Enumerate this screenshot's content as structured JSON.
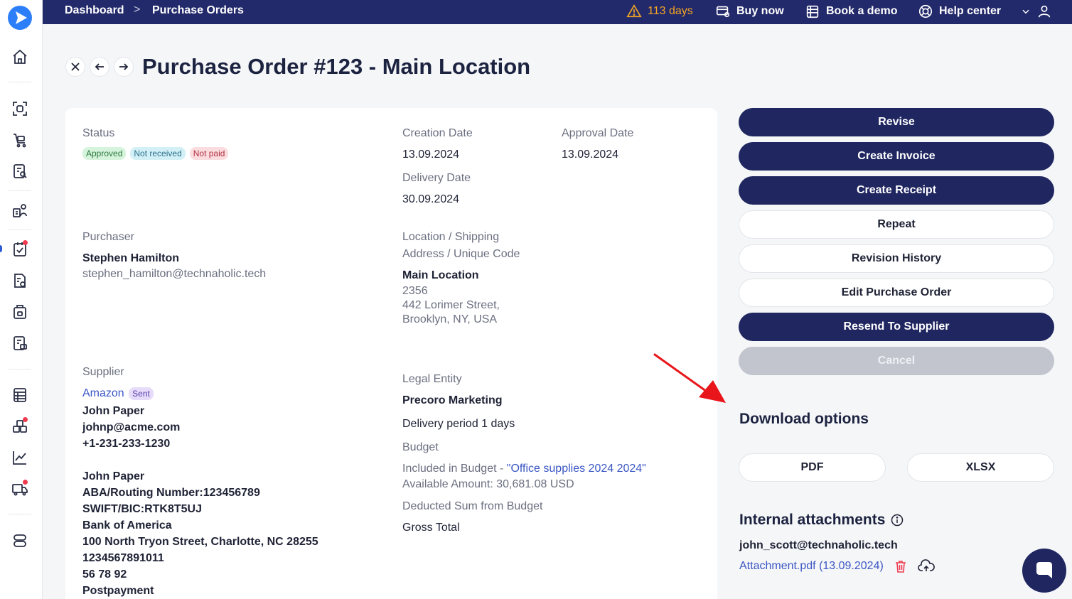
{
  "breadcrumb": {
    "home": "Dashboard",
    "separator": ">",
    "current": "Purchase Orders"
  },
  "topbar": {
    "trial": "113 days",
    "buy": "Buy now",
    "demo": "Book a demo",
    "help": "Help center"
  },
  "page": {
    "title": "Purchase Order #123 - Main Location"
  },
  "details": {
    "status_label": "Status",
    "badges": [
      "Approved",
      "Not received",
      "Not paid"
    ],
    "creation_label": "Creation Date",
    "creation_value": "13.09.2024",
    "approval_label": "Approval Date",
    "approval_value": "13.09.2024",
    "delivery_label": "Delivery Date",
    "delivery_value": "30.09.2024",
    "purchaser_label": "Purchaser",
    "purchaser_name": "Stephen Hamilton",
    "purchaser_email": "stephen_hamilton@technaholic.tech",
    "location_label_1": "Location / Shipping",
    "location_label_2": "Address / Unique Code",
    "location_name": "Main Location",
    "location_code": "2356",
    "location_addr_1": "442 Lorimer Street,",
    "location_addr_2": "Brooklyn, NY, USA",
    "supplier_label": "Supplier",
    "supplier_name": "Amazon",
    "supplier_badge": "Sent",
    "supplier_lines": [
      "John Paper",
      "johnp@acme.com",
      "+1-231-233-1230"
    ],
    "bank_lines": [
      "John Paper",
      "ABA/Routing Number:123456789",
      "SWIFT/BIC:RTK8T5UJ",
      "Bank of America",
      "100 North Tryon Street, Charlotte, NC 28255",
      "1234567891011",
      "56 78 92",
      "Postpayment"
    ],
    "legal_label": "Legal Entity",
    "legal_value": "Precoro Marketing",
    "delivery_period": "Delivery period 1 days",
    "budget_label": "Budget",
    "budget_prefix": "Included in Budget - ",
    "budget_link": "\"Office supplies 2024 2024\"",
    "available": "Available Amount: 30,681.08 USD",
    "deducted_label": "Deducted Sum from Budget",
    "deducted_value": "Gross Total"
  },
  "actions": [
    "Revise",
    "Create Invoice",
    "Create Receipt",
    "Repeat",
    "Revision History",
    "Edit Purchase Order",
    "Resend To Supplier",
    "Cancel"
  ],
  "download": {
    "title": "Download options",
    "pdf": "PDF",
    "xlsx": "XLSX"
  },
  "attachments": {
    "title": "Internal attachments",
    "user": "john_scott@technaholic.tech",
    "file": "Attachment.pdf (13.09.2024)"
  },
  "colors": {
    "topbar": "#232a6b",
    "primary": "#1f2660",
    "link": "#3b57c4",
    "warning": "#f5a623",
    "danger": "#ef3b4f",
    "arrow": "#e8161b"
  },
  "icons": {
    "logo": "play-logo-icon",
    "warning": "warning-icon",
    "chat": "chat-icon"
  }
}
